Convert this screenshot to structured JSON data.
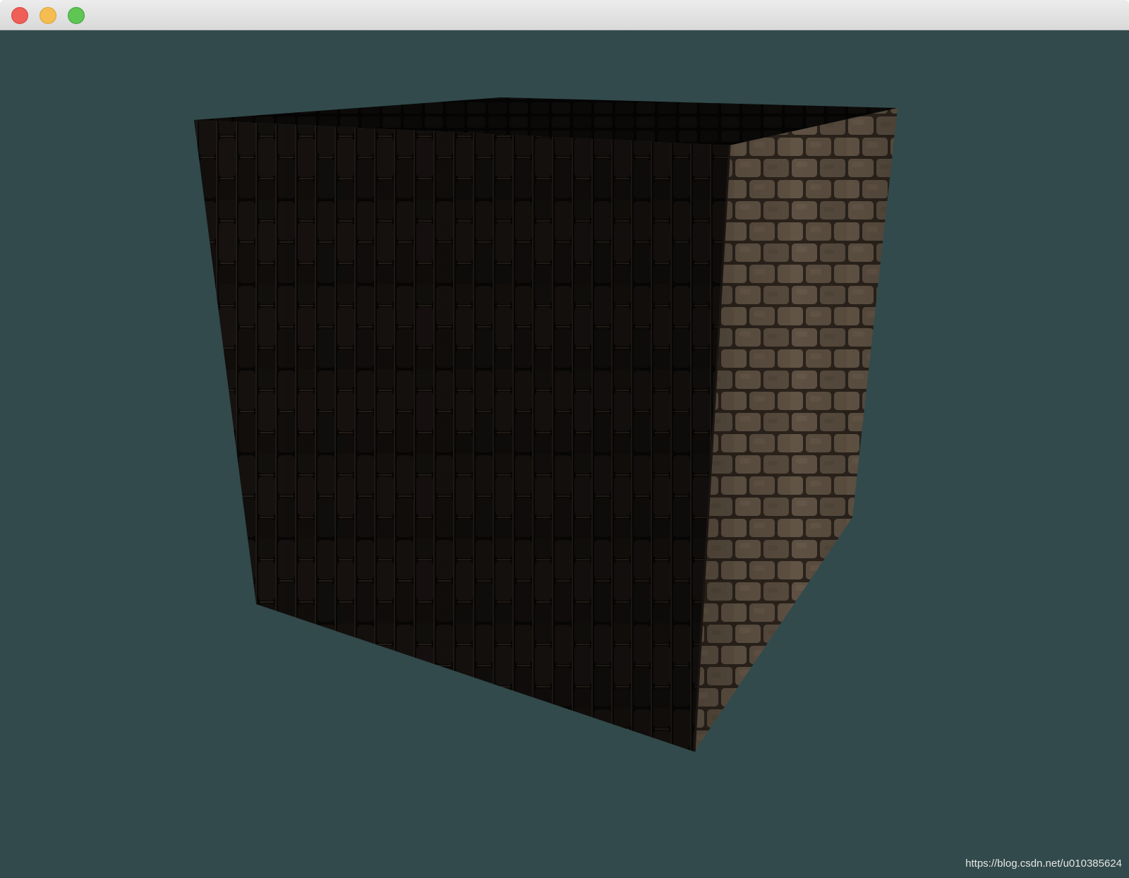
{
  "window": {
    "title": "",
    "controls": [
      "close",
      "minimize",
      "maximize"
    ]
  },
  "colors": {
    "clear_color": "#324a4b",
    "close": "#ee5f57",
    "minimize": "#f5bd4f",
    "maximize": "#5fc553",
    "brick_lit": "#5e5143",
    "brick_dark": "#0a0807",
    "mortar": "#2b231c"
  },
  "scene": {
    "object": "textured brick cube",
    "texture": "brick wall",
    "lit_face": "right",
    "dark_faces": [
      "front",
      "top"
    ]
  },
  "watermark": {
    "text": "https://blog.csdn.net/u010385624"
  }
}
